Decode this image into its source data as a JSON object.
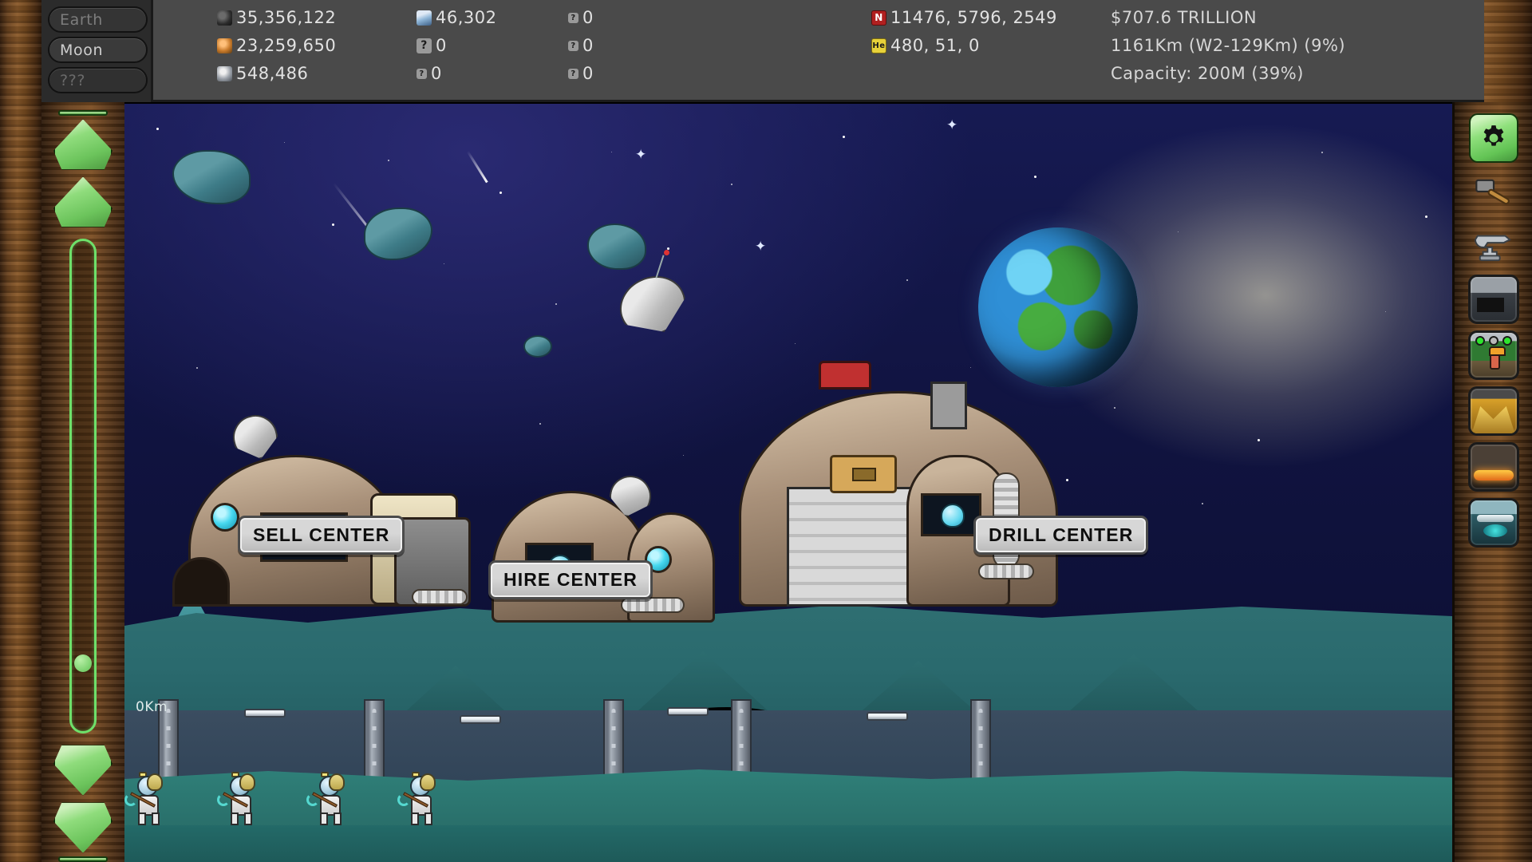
{
  "planet_tabs": [
    {
      "label": "Earth",
      "state": "dim"
    },
    {
      "label": "Moon",
      "state": "active"
    },
    {
      "label": "???",
      "state": "locked"
    }
  ],
  "stats": {
    "col1": [
      {
        "icon": "coal-ore-icon",
        "value": "35,356,122"
      },
      {
        "icon": "copper-ore-icon",
        "value": "23,259,650"
      },
      {
        "icon": "silver-ore-icon",
        "value": "548,486"
      }
    ],
    "col2": [
      {
        "icon": "gem-ore-icon",
        "value": "46,302"
      },
      {
        "icon": "unknown-resource-icon",
        "value": "0"
      },
      {
        "icon": "unknown-resource-icon",
        "value": "0"
      }
    ],
    "col3": [
      {
        "icon": "unknown-resource-icon",
        "value": "0"
      },
      {
        "icon": "unknown-resource-icon",
        "value": "0"
      },
      {
        "icon": "unknown-resource-icon",
        "value": "0"
      }
    ],
    "col4": [
      {
        "icon": "nitrogen-icon",
        "value": "11476, 5796, 2549"
      },
      {
        "icon": "helium-icon",
        "value": "480, 51, 0"
      }
    ],
    "col5": [
      {
        "label": "$707.6 TRILLION"
      },
      {
        "label": "1161Km (W2-129Km) (9%)"
      },
      {
        "label": "Capacity: 200M (39%)"
      }
    ]
  },
  "left_rail": {
    "up_fast_label": "scroll-up-fast",
    "up_label": "scroll-up",
    "down_label": "scroll-down",
    "down_fast_label": "scroll-down-fast",
    "slider_value": 8
  },
  "right_rail": {
    "settings_label": "settings",
    "items": [
      {
        "name": "hammer-icon"
      },
      {
        "name": "anvil-icon"
      },
      {
        "name": "factory-thumb"
      },
      {
        "name": "hire-thumb"
      },
      {
        "name": "gold-mine-thumb"
      },
      {
        "name": "lava-cave-thumb"
      },
      {
        "name": "ice-cave-thumb"
      }
    ]
  },
  "scene": {
    "signs": [
      {
        "label": "SELL CENTER"
      },
      {
        "label": "HIRE CENTER"
      },
      {
        "label": "DRILL CENTER"
      }
    ],
    "depth_label": "0Km",
    "miner_count": 4
  },
  "colors": {
    "accent_green": "#6ee06a",
    "wood": "#7d4f24",
    "bar_bg": "#4a4a4a",
    "sky": "#10133f"
  }
}
